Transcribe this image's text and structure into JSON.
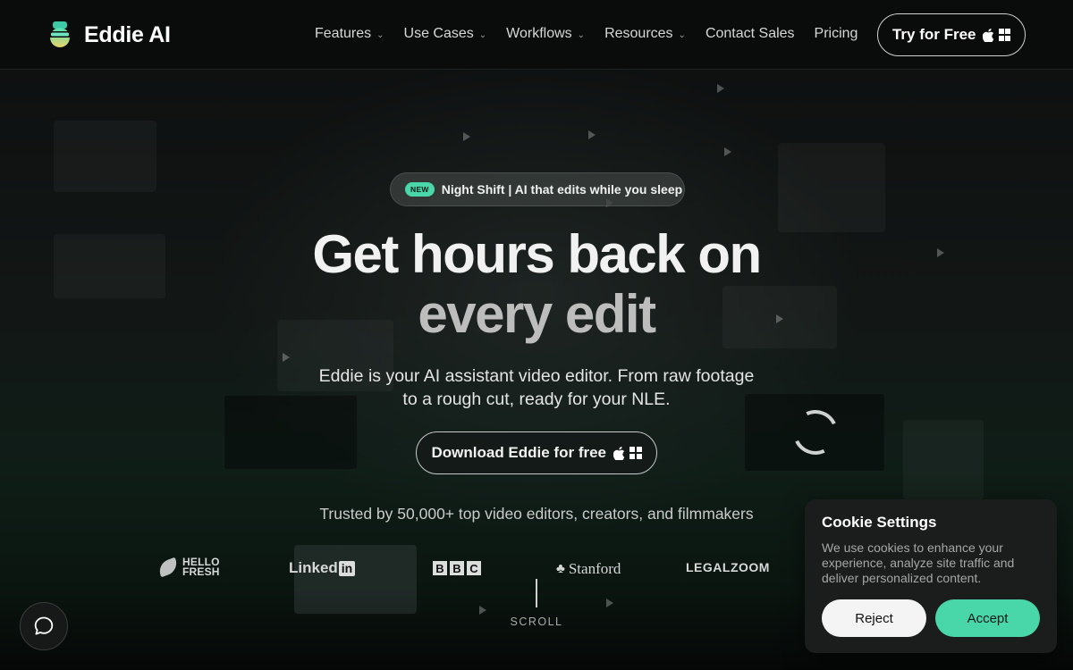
{
  "header": {
    "logo_text": "Eddie AI",
    "nav": [
      {
        "label": "Features",
        "has_dropdown": true
      },
      {
        "label": "Use Cases",
        "has_dropdown": true
      },
      {
        "label": "Workflows",
        "has_dropdown": true
      },
      {
        "label": "Resources",
        "has_dropdown": true
      },
      {
        "label": "Contact Sales",
        "has_dropdown": false
      },
      {
        "label": "Pricing",
        "has_dropdown": false
      }
    ],
    "cta_label": "Try for Free"
  },
  "hero": {
    "badge_tag": "NEW",
    "badge_text": "Night Shift | AI that edits while you sleep",
    "headline_line1": "Get hours back on",
    "headline_line2": "every edit",
    "sub_line1": "Eddie is your AI assistant video editor. From raw footage",
    "sub_line2": "to a rough cut, ready for your NLE.",
    "cta_label": "Download Eddie for free",
    "trusted_text": "Trusted by 50,000+ top video editors, creators, and filmmakers"
  },
  "brands": {
    "hellofresh_line1": "HELLO",
    "hellofresh_line2": "FRESH",
    "linkedin_a": "Linked",
    "linkedin_b": "in",
    "bbc": [
      "B",
      "B",
      "C"
    ],
    "stanford": "Stanford",
    "legalzoom": "LEGALZOOM"
  },
  "scroll_label": "SCROLL",
  "cookie": {
    "title": "Cookie Settings",
    "body": "We use cookies to enhance your experience, analyze site traffic and deliver personalized content.",
    "reject_label": "Reject",
    "accept_label": "Accept"
  },
  "icons": {
    "apple": "apple-icon",
    "windows": "windows-icon",
    "chat": "chat-bubble-icon",
    "chevron": "chevron-down-icon"
  },
  "colors": {
    "accent": "#49d6a8",
    "background": "#0b0d0c"
  }
}
